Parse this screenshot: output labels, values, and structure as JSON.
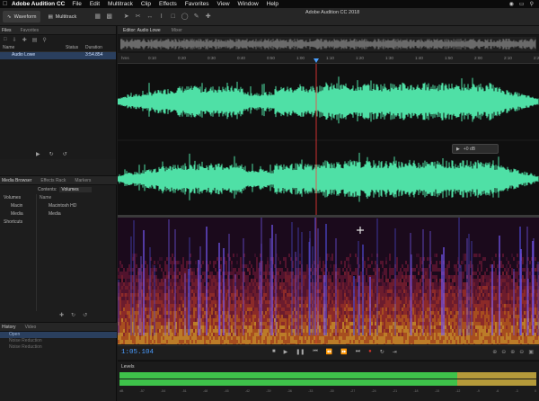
{
  "menubar": {
    "app_name": "Adobe Audition CC",
    "items": [
      "File",
      "Edit",
      "Multitrack",
      "Clip",
      "Effects",
      "Favorites",
      "View",
      "Window",
      "Help"
    ]
  },
  "toolbar": {
    "waveform_label": "Waveform",
    "multitrack_label": "Multitrack",
    "window_title": "Adobe Audition CC 2018"
  },
  "files_panel": {
    "tabs": [
      "Files",
      "Favorites"
    ],
    "columns": {
      "name": "Name",
      "status": "Status",
      "duration": "Duration"
    },
    "rows": [
      {
        "name": "Audio Lowe",
        "status": "",
        "duration": "3:54.854"
      }
    ]
  },
  "media_panel": {
    "tabs": [
      "Media Browser",
      "Effects Rack",
      "Markers"
    ],
    "contents_label": "Contents:",
    "contents_value": "Volumes",
    "tree": [
      "Volumes",
      "Macin",
      "Media",
      "Shortcuts"
    ],
    "list_header": "Name",
    "list": [
      "Macintosh HD",
      "Media"
    ]
  },
  "history_panel": {
    "tabs": [
      "History",
      "Video"
    ],
    "items": [
      "Open",
      "Noise Reduction",
      "Noise Reduction"
    ]
  },
  "editor": {
    "tabs": [
      "Editor: Audio Lowe",
      "Mixer"
    ],
    "ruler_unit": "hms",
    "ruler_ticks": [
      "0:10",
      "0:20",
      "0:30",
      "0:40",
      "0:50",
      "1:00",
      "1:10",
      "1:20",
      "1:30",
      "1:40",
      "1:50",
      "2:00",
      "2:10",
      "2:20"
    ],
    "hud_value": "+0 dB",
    "current_time": "1:05.104"
  },
  "levels": {
    "title": "Levels",
    "scale": [
      "dB",
      "-57",
      "-54",
      "-51",
      "-48",
      "-45",
      "-42",
      "-39",
      "-36",
      "-33",
      "-30",
      "-27",
      "-24",
      "-21",
      "-18",
      "-15",
      "-12",
      "-9",
      "-6",
      "-3",
      "0"
    ],
    "green_fraction": 0.81,
    "yellow_fraction": 0.19
  },
  "colors": {
    "waveform": "#4fe0a6",
    "playhead": "#ff3b3b",
    "accent": "#4a9cff",
    "record": "#d8352a"
  }
}
